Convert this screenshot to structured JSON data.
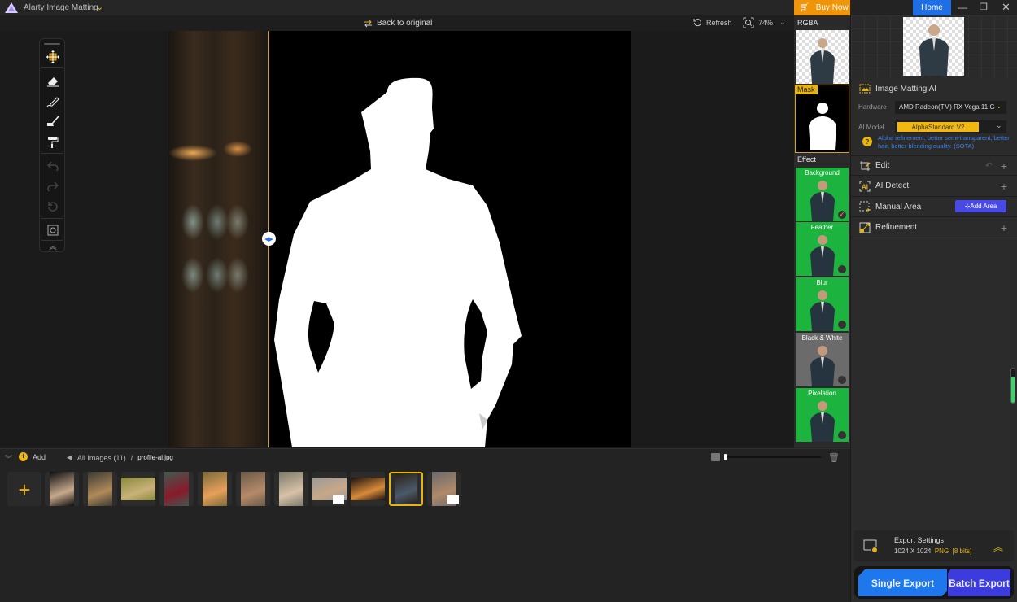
{
  "app": {
    "title": "Alarty Image Matting"
  },
  "topbar": {
    "back_to_original": "Back to original",
    "refresh": "Refresh",
    "zoom": "74%"
  },
  "toolbar": {
    "tools": [
      "move",
      "eraser",
      "brush",
      "paint-brush",
      "roller",
      "undo",
      "redo",
      "reset",
      "fit-screen",
      "collapse"
    ]
  },
  "strip": {
    "buy_now": "Buy Now",
    "rgba_label": "RGBA",
    "mask_label": "Mask",
    "effect_label": "Effect",
    "effects": [
      {
        "label": "Background",
        "bg": "#1db33f",
        "selected": true
      },
      {
        "label": "Feather",
        "bg": "#1db33f",
        "selected": false
      },
      {
        "label": "Blur",
        "bg": "#1db33f",
        "selected": false
      },
      {
        "label": "Black & White",
        "bg": "#6b6b6b",
        "selected": false
      },
      {
        "label": "Pixelation",
        "bg": "#1db33f",
        "selected": false
      }
    ]
  },
  "window": {
    "home": "Home"
  },
  "panel": {
    "matting_title": "Image Matting AI",
    "hardware_label": "Hardware",
    "hardware_value": "AMD Radeon(TM) RX Vega 11 G",
    "model_label": "AI Model",
    "model_value": "AlphaStandard  V2",
    "model_desc": "Alpha refinement, better semi-transparent, better hair, better blending quality. (SOTA)",
    "sections": [
      {
        "label": "Edit"
      },
      {
        "label": "AI Detect"
      },
      {
        "label": "Manual Area",
        "action": "Add Area"
      },
      {
        "label": "Refinement"
      }
    ],
    "export": {
      "title": "Export Settings",
      "size": "1024 X 1024",
      "format": "PNG",
      "bits": "[8 bits]",
      "single": "Single Export",
      "batch": "Batch Export"
    }
  },
  "bottom": {
    "add": "Add",
    "all_images": "All Images (11)",
    "separator": "/",
    "current_file": "profile-ai.jpg",
    "thumbnails": [
      {
        "name": "jellyfish",
        "colors": [
          "#0d0d0d",
          "#c7a98d"
        ]
      },
      {
        "name": "feathers",
        "colors": [
          "#3a3a33",
          "#b08a5a"
        ]
      },
      {
        "name": "bicycle",
        "colors": [
          "#8a8a3a",
          "#c9b27a"
        ]
      },
      {
        "name": "red-dress-forest",
        "colors": [
          "#3f5a52",
          "#8a1a2a"
        ]
      },
      {
        "name": "flower-bouquet-woman",
        "colors": [
          "#7a6a3a",
          "#e7a05a"
        ]
      },
      {
        "name": "woman-roses",
        "colors": [
          "#6a5a4a",
          "#b58a6a"
        ]
      },
      {
        "name": "woman-flowers",
        "colors": [
          "#7a7a6a",
          "#d8c2a8"
        ]
      },
      {
        "name": "blonde-woman",
        "colors": [
          "#9a9a9a",
          "#c8a888"
        ]
      },
      {
        "name": "lights-bokeh",
        "colors": [
          "#1a1010",
          "#d88a3a"
        ]
      },
      {
        "name": "profile-ai",
        "colors": [
          "#2a2218",
          "#4a5a6a"
        ],
        "selected": true
      },
      {
        "name": "bearded-man",
        "colors": [
          "#6a6a6a",
          "#b08a6a"
        ]
      }
    ]
  },
  "colors": {
    "accent": "#e8b40d",
    "blue": "#1f77ee",
    "purple": "#3c3cde",
    "green": "#1db33f",
    "orange": "#f0940a"
  }
}
